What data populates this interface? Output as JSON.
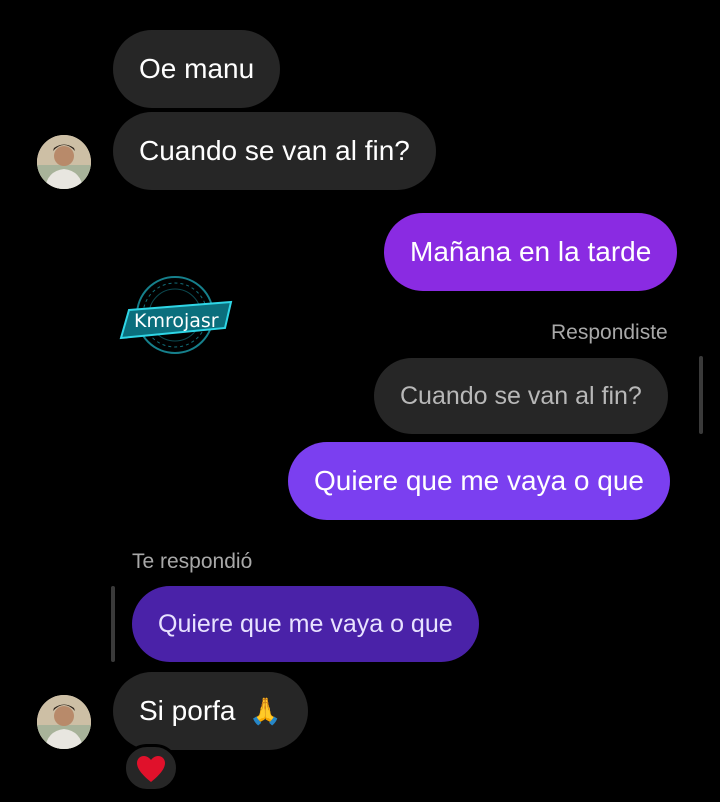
{
  "colors": {
    "background": "#000000",
    "incoming_bubble": "#262626",
    "outgoing_top": "#8a2be2",
    "outgoing_bottom": "#7b3ff0",
    "quoted_by_them": "#4a22a8",
    "secondary_text": "#a8a8a8"
  },
  "messages": {
    "m1": "Oe manu",
    "m2": "Cuando se van al fin?",
    "m3": "Mañana en la tarde",
    "m4_reply_label": "Respondiste",
    "m4_quoted": "Cuando se van al fin?",
    "m4": "Quiere que me vaya o que",
    "m5_reply_label": "Te respondió",
    "m5_quoted": "Quiere que me vaya o que",
    "m6": "Si porfa",
    "m6_emoji": "🙏",
    "reaction": "❤️"
  },
  "watermark": {
    "text": "Kmrojasr"
  },
  "icons": {
    "avatar": "profile-photo",
    "reaction": "heart-icon"
  }
}
